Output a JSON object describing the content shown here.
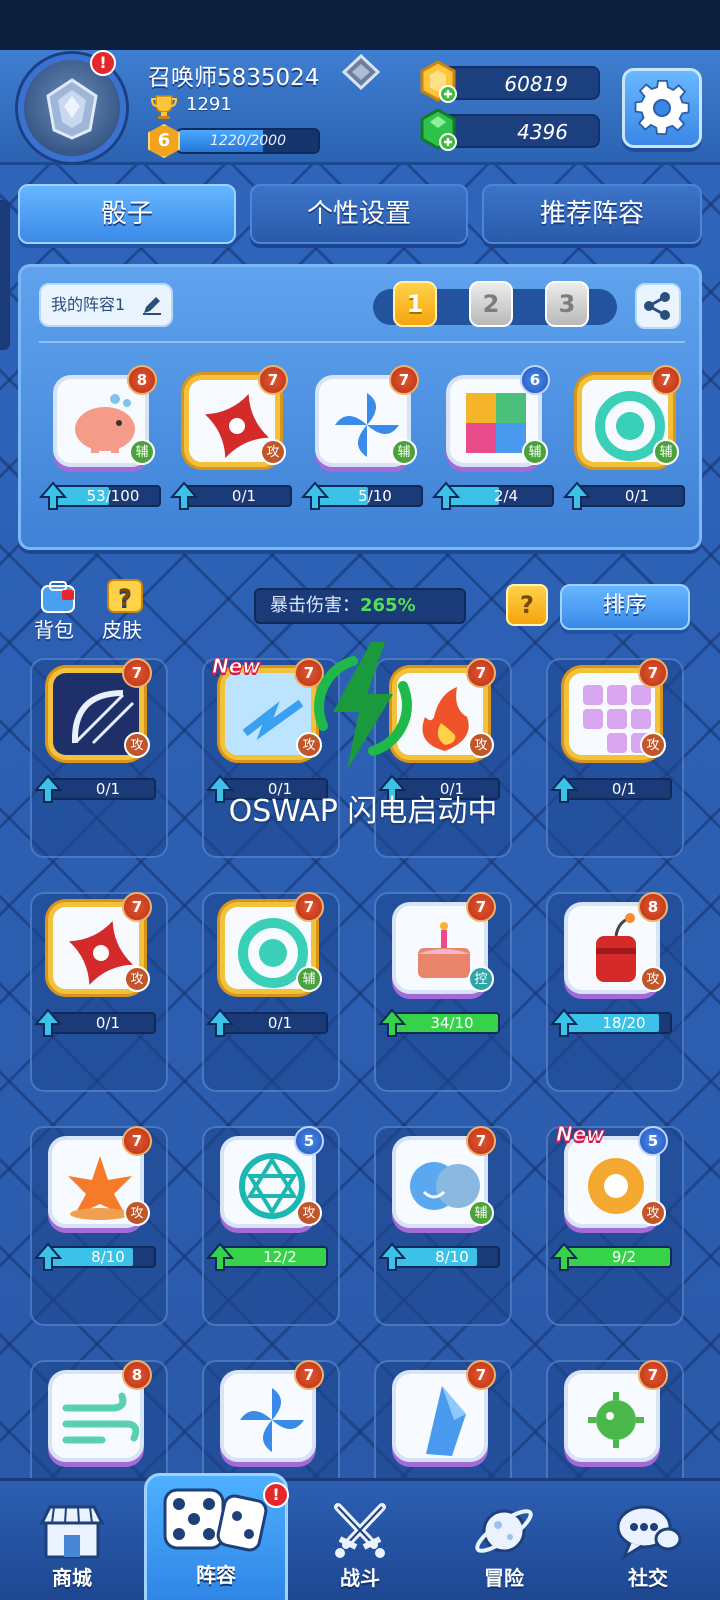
{
  "header": {
    "player_name": "召唤师5835024",
    "trophies": "1291",
    "level": "6",
    "xp_text": "1220/2000",
    "xp_progress": 0.61,
    "alert_badge": "!",
    "gold": "60819",
    "gems": "4396",
    "icons": [
      "player-emblem-icon",
      "rank-icon",
      "trophy-icon",
      "gold-coin-icon",
      "green-gem-icon",
      "gear-icon"
    ]
  },
  "tabs": [
    {
      "label": "骰子",
      "active": true
    },
    {
      "label": "个性设置",
      "active": false
    },
    {
      "label": "推荐阵容",
      "active": false
    }
  ],
  "deck": {
    "name": "我的阵容1",
    "slots": [
      "1",
      "2",
      "3"
    ],
    "active_slot": "1",
    "dice": [
      {
        "icon": "piggy-bank-dice-icon",
        "level": "8",
        "role": "辅",
        "progress": "53/100",
        "fill": 0.53,
        "legend": false,
        "level_color": "red"
      },
      {
        "icon": "shuriken-dice-icon",
        "level": "7",
        "role": "攻",
        "progress": "0/1",
        "fill": 0.0,
        "legend": true,
        "level_color": "red"
      },
      {
        "icon": "pinwheel-dice-icon",
        "level": "7",
        "role": "辅",
        "progress": "5/10",
        "fill": 0.5,
        "legend": false,
        "level_color": "red"
      },
      {
        "icon": "puzzle-dice-icon",
        "level": "6",
        "role": "辅",
        "progress": "2/4",
        "fill": 0.5,
        "legend": false,
        "level_color": "blue"
      },
      {
        "icon": "vortex-dice-icon",
        "level": "7",
        "role": "辅",
        "progress": "0/1",
        "fill": 0.0,
        "legend": true,
        "level_color": "red"
      }
    ]
  },
  "side_buttons": {
    "bag": "背包",
    "skin": "皮肤"
  },
  "crit": {
    "label": "暴击伤害：",
    "value": "265%"
  },
  "help_label": "?",
  "sort_label": "排序",
  "overlay_text": "OSWAP 闪电启动中",
  "new_label": "New",
  "collection": [
    {
      "icon": "bow-dice-icon",
      "level": "7",
      "role": "攻",
      "progress": "0/1",
      "fill": 0.0,
      "legend": true,
      "new": false,
      "level_color": "red"
    },
    {
      "icon": "lightning-dice-icon",
      "level": "7",
      "role": "攻",
      "progress": "0/1",
      "fill": 0.0,
      "legend": true,
      "new": true,
      "level_color": "red"
    },
    {
      "icon": "fire-dice-icon",
      "level": "7",
      "role": "攻",
      "progress": "0/1",
      "fill": 0.0,
      "legend": true,
      "new": false,
      "level_color": "red"
    },
    {
      "icon": "blocks-dice-icon",
      "level": "7",
      "role": "攻",
      "progress": "0/1",
      "fill": 0.0,
      "legend": true,
      "new": false,
      "level_color": "red"
    },
    {
      "icon": "shuriken-dice-icon",
      "level": "7",
      "role": "攻",
      "progress": "0/1",
      "fill": 0.0,
      "legend": true,
      "new": false,
      "level_color": "red"
    },
    {
      "icon": "vortex-dice-icon",
      "level": "7",
      "role": "辅",
      "progress": "0/1",
      "fill": 0.0,
      "legend": true,
      "new": false,
      "level_color": "red"
    },
    {
      "icon": "cake-dice-icon",
      "level": "7",
      "role": "控",
      "progress": "34/10",
      "fill": 1.0,
      "legend": false,
      "new": false,
      "level_color": "red"
    },
    {
      "icon": "dynamite-dice-icon",
      "level": "8",
      "role": "攻",
      "progress": "18/20",
      "fill": 0.9,
      "legend": false,
      "new": false,
      "level_color": "red"
    },
    {
      "icon": "explosion-dice-icon",
      "level": "7",
      "role": "攻",
      "progress": "8/10",
      "fill": 0.8,
      "legend": false,
      "new": false,
      "level_color": "red"
    },
    {
      "icon": "crystal-dice-icon",
      "level": "5",
      "role": "攻",
      "progress": "12/2",
      "fill": 1.0,
      "legend": false,
      "new": false,
      "level_color": "blue"
    },
    {
      "icon": "masks-dice-icon",
      "level": "7",
      "role": "辅",
      "progress": "8/10",
      "fill": 0.8,
      "legend": false,
      "new": false,
      "level_color": "red"
    },
    {
      "icon": "gear-dice-icon",
      "level": "5",
      "role": "攻",
      "progress": "9/2",
      "fill": 1.0,
      "legend": false,
      "new": true,
      "level_color": "blue"
    },
    {
      "icon": "wind-dice-icon",
      "level": "8",
      "role": "",
      "progress": "",
      "fill": 0.0,
      "legend": false,
      "new": false,
      "level_color": "red"
    },
    {
      "icon": "pinwheel-dice-icon",
      "level": "7",
      "role": "",
      "progress": "",
      "fill": 0.0,
      "legend": false,
      "new": false,
      "level_color": "red"
    },
    {
      "icon": "ice-dice-icon",
      "level": "7",
      "role": "",
      "progress": "",
      "fill": 0.0,
      "legend": false,
      "new": false,
      "level_color": "red"
    },
    {
      "icon": "virus-dice-icon",
      "level": "7",
      "role": "",
      "progress": "",
      "fill": 0.0,
      "legend": false,
      "new": false,
      "level_color": "red"
    }
  ],
  "bottom_nav": [
    {
      "label": "商城",
      "icon": "shop-icon",
      "active": false,
      "alert": ""
    },
    {
      "label": "阵容",
      "icon": "dice-icon",
      "active": true,
      "alert": "!"
    },
    {
      "label": "战斗",
      "icon": "crossed-swords-icon",
      "active": false,
      "alert": ""
    },
    {
      "label": "冒险",
      "icon": "planet-icon",
      "active": false,
      "alert": ""
    },
    {
      "label": "社交",
      "icon": "chat-bubble-icon",
      "active": false,
      "alert": ""
    }
  ],
  "colors": {
    "accent": "#3a8ae8",
    "gold": "#f5a40e",
    "green": "#35d24a",
    "alert": "#e5262a"
  }
}
